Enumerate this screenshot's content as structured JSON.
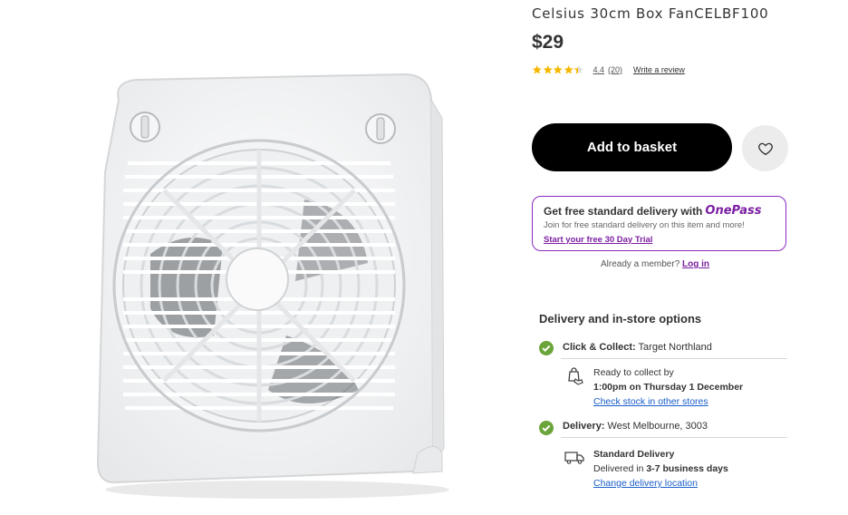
{
  "product": {
    "title": "Celsius 30cm Box FanCELBF100",
    "price": "$29",
    "rating": {
      "value": 4.4,
      "score": "4.4",
      "count": "(20)",
      "write_review": "Write a review"
    }
  },
  "actions": {
    "add_to_basket": "Add to basket"
  },
  "onepass": {
    "heading": "Get free standard delivery with",
    "brand": "OnePass",
    "subtext": "Join for free standard delivery on this item and more!",
    "trial_link": "Start your free 30 Day Trial",
    "member_text": "Already a member?",
    "login_link": "Log in"
  },
  "delivery": {
    "heading": "Delivery and in-store options",
    "click_collect": {
      "label": "Click & Collect:",
      "store": "Target Northland",
      "ready_line": "Ready to collect by",
      "time": "1:00pm on Thursday 1 December",
      "link": "Check stock in other stores"
    },
    "home": {
      "label": "Delivery:",
      "location": "West Melbourne, 3003",
      "method": "Standard Delivery",
      "eta_prefix": "Delivered in",
      "eta": "3-7 business days",
      "link": "Change delivery location"
    }
  },
  "colors": {
    "accent_purple": "#7b1fa2",
    "check_green": "#6ba53a",
    "star_gold": "#f5b800",
    "link_blue": "#1a5dc9"
  },
  "icons": {
    "wishlist": "heart-icon",
    "collect": "bag-hand-icon",
    "delivery": "truck-icon",
    "check": "check-circle-icon"
  }
}
